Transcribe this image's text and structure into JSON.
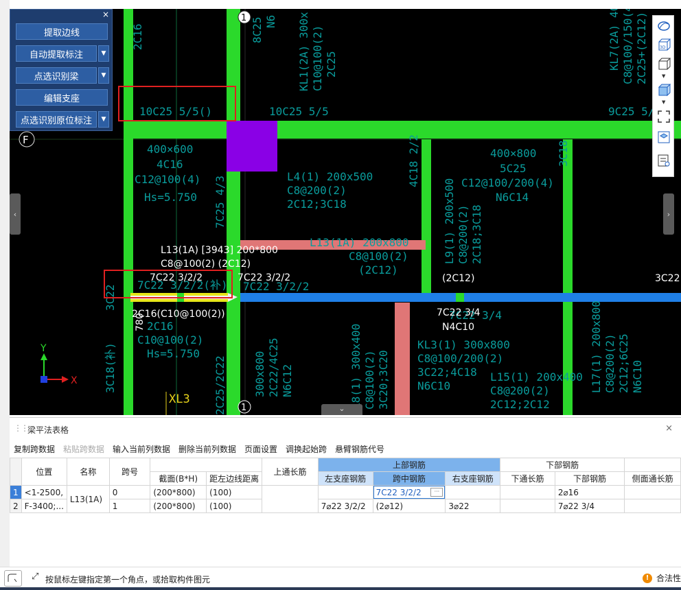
{
  "panel": {
    "close_icon": "×",
    "buttons": [
      {
        "label": "提取边线",
        "dropdown": false
      },
      {
        "label": "自动提取标注",
        "dropdown": true
      },
      {
        "label": "点选识别梁",
        "dropdown": true
      },
      {
        "label": "编辑支座",
        "dropdown": false
      },
      {
        "label": "点选识别原位标注",
        "dropdown": true
      }
    ]
  },
  "cad": {
    "axis_labels": {
      "axis_1_top": "1",
      "axis_1_bottom": "1",
      "axis_f": "F"
    },
    "texts": {
      "t1": "2C16",
      "t2": "10C25 5/5()",
      "t3": "10C25 5/5",
      "t4": "9C25 5/",
      "t5": "400×600",
      "t6": "4C16",
      "t7": "C12@100(4)",
      "t8": "Hs=5.750",
      "t9": "7C25 4/3",
      "t10": "L4(1) 200x500",
      "t11": "C8@200(2)",
      "t12": "2C12;3C18",
      "t13": "4C18 2/2",
      "t14": "400×800",
      "t15": "5C25",
      "t16": "C12@100/200(4)",
      "t17": "N6C14",
      "t18": "3C18",
      "t19": "L13(1A) 200x800",
      "t20": "C8@100(2)",
      "t21": "(2C12)",
      "t22": "L9(1) 200x500",
      "t23": "C8@200(2)",
      "t24": "2C18;3C18",
      "t25": "(2C12)",
      "t26": "3C22",
      "t27": "7C22 3/2/2",
      "t28": "7C22 3/2/2(补)",
      "t29": "7C22 3/4",
      "t30": "2C16",
      "t31": "C10@100(2)",
      "t32": "Hs=5.750",
      "t33": "300x800",
      "t34": "2C22/4C25",
      "t35": "N6C12",
      "t36": "L8(1) 300x400",
      "t37": "C8@100(2)",
      "t38": "3C20;3C20",
      "t39": "KL3(1) 300x800",
      "t40": "C8@100/200(2)",
      "t41": "3C22;4C18",
      "t42": "N6C10",
      "t43": "L15(1) 200x400",
      "t44": "C8@200(2)",
      "t45": "2C12;2C12",
      "t46": "L17(1) 200x800",
      "t47": "C8@200(2)",
      "t48": "2C12;6C25",
      "t49": "N6C10",
      "t50": "KL1(2A) 300x",
      "t51": "C10@100(2)",
      "t52": "2C25",
      "t53": "8C25",
      "t54": "N6",
      "t55": "KL7(2A) 400",
      "t56": "C8@100/150(4",
      "t57": "2C25+(2C12)",
      "t58": "3C18(补)",
      "t59": "XL3",
      "t60": "2C25/2C22"
    },
    "white_labels": {
      "w1": "L13(1A) [3943] 200*800",
      "w2": "C8@100(2) (2C12)",
      "w3": "7C22 3/2/2",
      "w4": "7C22 3/2/2",
      "w5": "(2C12)",
      "w6": "3C22",
      "w7": "2C16(C10@100(2))",
      "w8": "780",
      "w9": "7C22 3/4",
      "w10": "N4C10"
    },
    "coord_axes": {
      "y": "Y",
      "x": "X"
    }
  },
  "right_toolbar": {
    "icons": [
      "rotate-view-icon",
      "3d-view-icon",
      "cube-view-icon",
      "solid-cube-icon",
      "fit-view-icon",
      "top-view-icon",
      "layer-settings-icon"
    ]
  },
  "side_tabs": {
    "left": "‹",
    "right": "›",
    "bottom": "⌄"
  },
  "table_panel": {
    "title": "梁平法表格",
    "close": "×",
    "toolbar": [
      "复制跨数据",
      "粘贴跨数据",
      "输入当前列数据",
      "删除当前列数据",
      "页面设置",
      "调换起始跨",
      "悬臂钢筋代号"
    ],
    "disabled_toolbar_index": 1,
    "headers": {
      "position": "位置",
      "name": "名称",
      "span": "跨号",
      "section": "截面(B*H)",
      "edge_dist": "距左边线距离",
      "top_through": "上通长筋",
      "top_group": "上部钢筋",
      "left_seat": "左支座钢筋",
      "mid_span": "跨中钢筋",
      "right_seat": "右支座钢筋",
      "bottom_group": "下部钢筋",
      "bottom_through": "下通长筋",
      "bottom_bar": "下部钢筋",
      "side_through": "侧面通长筋"
    },
    "rows": [
      {
        "rn": "1",
        "position": "<1-2500,",
        "name": "L13(1A)",
        "span": "0",
        "section": "(200*800)",
        "edge_dist": "(100)",
        "top_through": "",
        "left_seat": "",
        "mid_span": "7C22 3/2/2",
        "right_seat": "",
        "bottom_through": "",
        "bottom_bar": "2⌀16",
        "side_through": ""
      },
      {
        "rn": "2",
        "position": "F-3400;...",
        "name": "",
        "span": "1",
        "section": "(200*800)",
        "edge_dist": "(100)",
        "top_through": "",
        "left_seat": "7⌀22 3/2/2",
        "mid_span": "(2⌀12)",
        "right_seat": "3⌀22",
        "bottom_through": "",
        "bottom_bar": "7⌀22 3/4",
        "side_through": ""
      }
    ]
  },
  "status": {
    "message": "按鼠标左键指定第一个角点，或拾取构件图元",
    "warning": "合法性"
  }
}
